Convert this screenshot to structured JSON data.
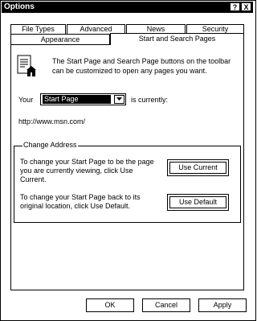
{
  "window": {
    "title": "Options",
    "help_button": "?",
    "close_button": "X"
  },
  "tabs": {
    "row1": [
      {
        "label": "File Types"
      },
      {
        "label": "Advanced"
      },
      {
        "label": "News"
      },
      {
        "label": "Security"
      }
    ],
    "row2": [
      {
        "label": "Appearance"
      },
      {
        "label": "Start and Search Pages",
        "active": true
      }
    ]
  },
  "panel": {
    "description": "The Start Page and Search Page buttons on the toolbar can be customized to open any pages you want.",
    "your_label": "Your",
    "page_select": {
      "selected": "Start Page"
    },
    "is_currently": "is currently:",
    "current_url": "http://www.msn.com/"
  },
  "change_address": {
    "legend": "Change Address",
    "use_current_text": "To change your Start Page to be the page you are currently viewing, click Use Current.",
    "use_current_button": "Use Current",
    "use_default_text": "To change your Start Page back to its original location, click Use Default.",
    "use_default_button": "Use Default"
  },
  "footer": {
    "ok": "OK",
    "cancel": "Cancel",
    "apply": "Apply"
  }
}
